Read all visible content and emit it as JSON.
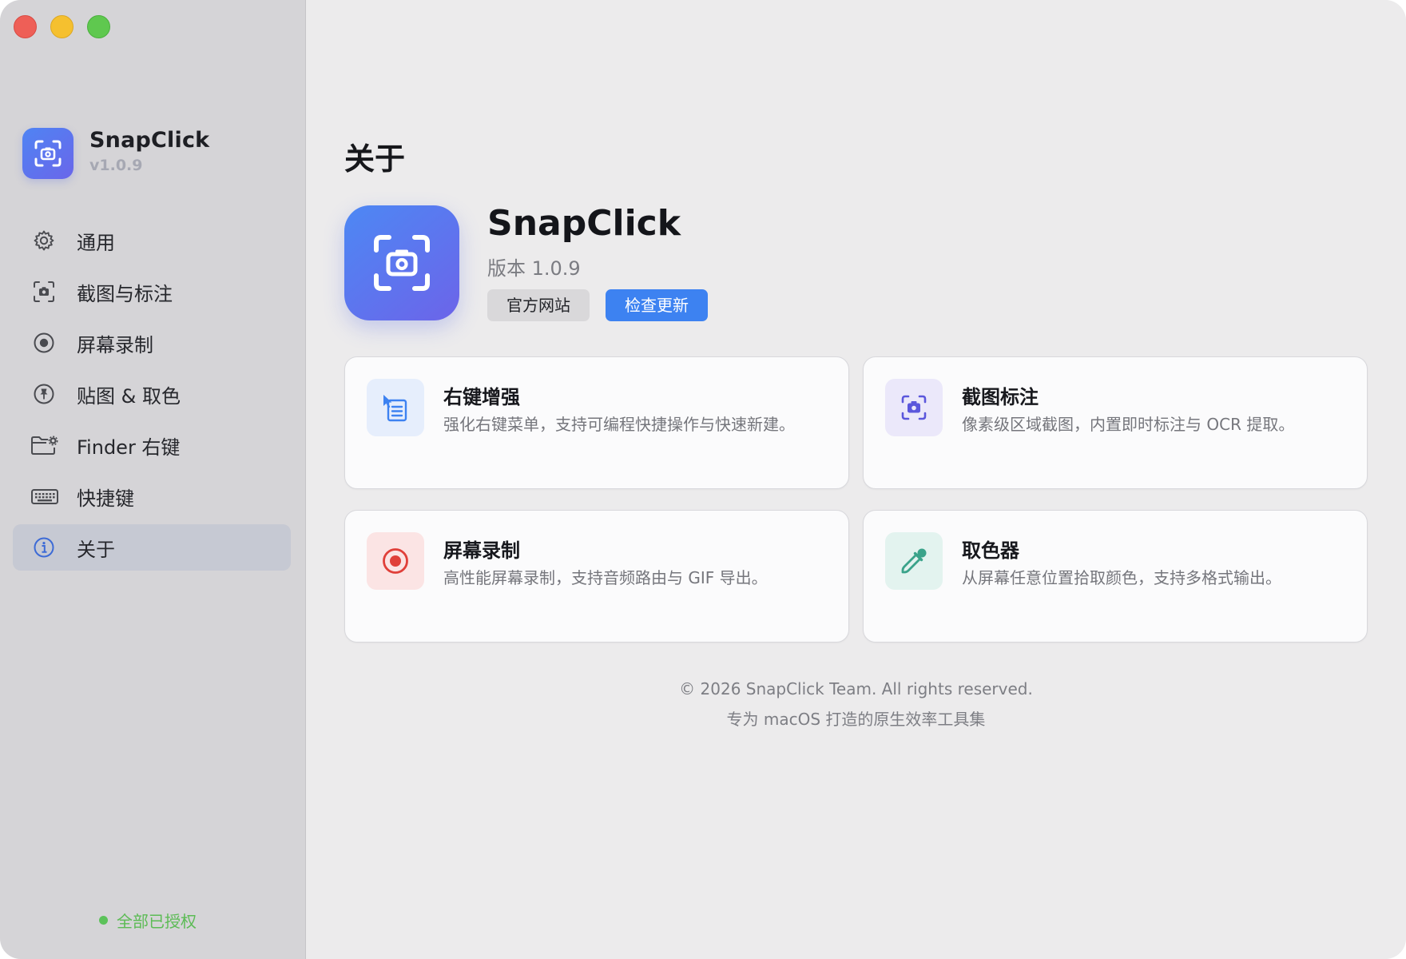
{
  "sidebar": {
    "brand": {
      "name": "SnapClick",
      "version": "v1.0.9"
    },
    "items": [
      {
        "label": "通用",
        "icon": "gear-icon",
        "active": false
      },
      {
        "label": "截图与标注",
        "icon": "screenshot-icon",
        "active": false
      },
      {
        "label": "屏幕录制",
        "icon": "record-icon",
        "active": false
      },
      {
        "label": "贴图 & 取色",
        "icon": "pin-icon",
        "active": false
      },
      {
        "label": "Finder 右键",
        "icon": "folder-gear-icon",
        "active": false
      },
      {
        "label": "快捷键",
        "icon": "keyboard-icon",
        "active": false
      },
      {
        "label": "关于",
        "icon": "info-icon",
        "active": true
      }
    ],
    "status": {
      "text": "全部已授权",
      "color": "#5cc25a"
    }
  },
  "main": {
    "title": "关于",
    "app": {
      "name": "SnapClick",
      "version_text": "版本 1.0.9",
      "website_button": "官方网站",
      "update_button": "检查更新"
    },
    "features": [
      {
        "title": "右键增强",
        "desc": "强化右键菜单，支持可编程快捷操作与快速新建。",
        "icon": "menu-cursor-icon",
        "icon_bg": "#e6eefc"
      },
      {
        "title": "截图标注",
        "desc": "像素级区域截图，内置即时标注与 OCR 提取。",
        "icon": "screenshot-icon",
        "icon_bg": "#ebe8fa"
      },
      {
        "title": "屏幕录制",
        "desc": "高性能屏幕录制，支持音频路由与 GIF 导出。",
        "icon": "record-icon",
        "icon_bg": "#fbe4e4"
      },
      {
        "title": "取色器",
        "desc": "从屏幕任意位置拾取颜色，支持多格式输出。",
        "icon": "eyedropper-icon",
        "icon_bg": "#e3f3ef"
      }
    ],
    "footer": {
      "copyright": "© 2026 SnapClick Team. All rights reserved.",
      "tagline": "专为 macOS 打造的原生效率工具集"
    }
  },
  "colors": {
    "accent": "#3d82f1",
    "brand_gradient_start": "#4f84f3",
    "brand_gradient_end": "#6a66ea",
    "record_red": "#e0403a",
    "picker_teal": "#3aa38a"
  }
}
